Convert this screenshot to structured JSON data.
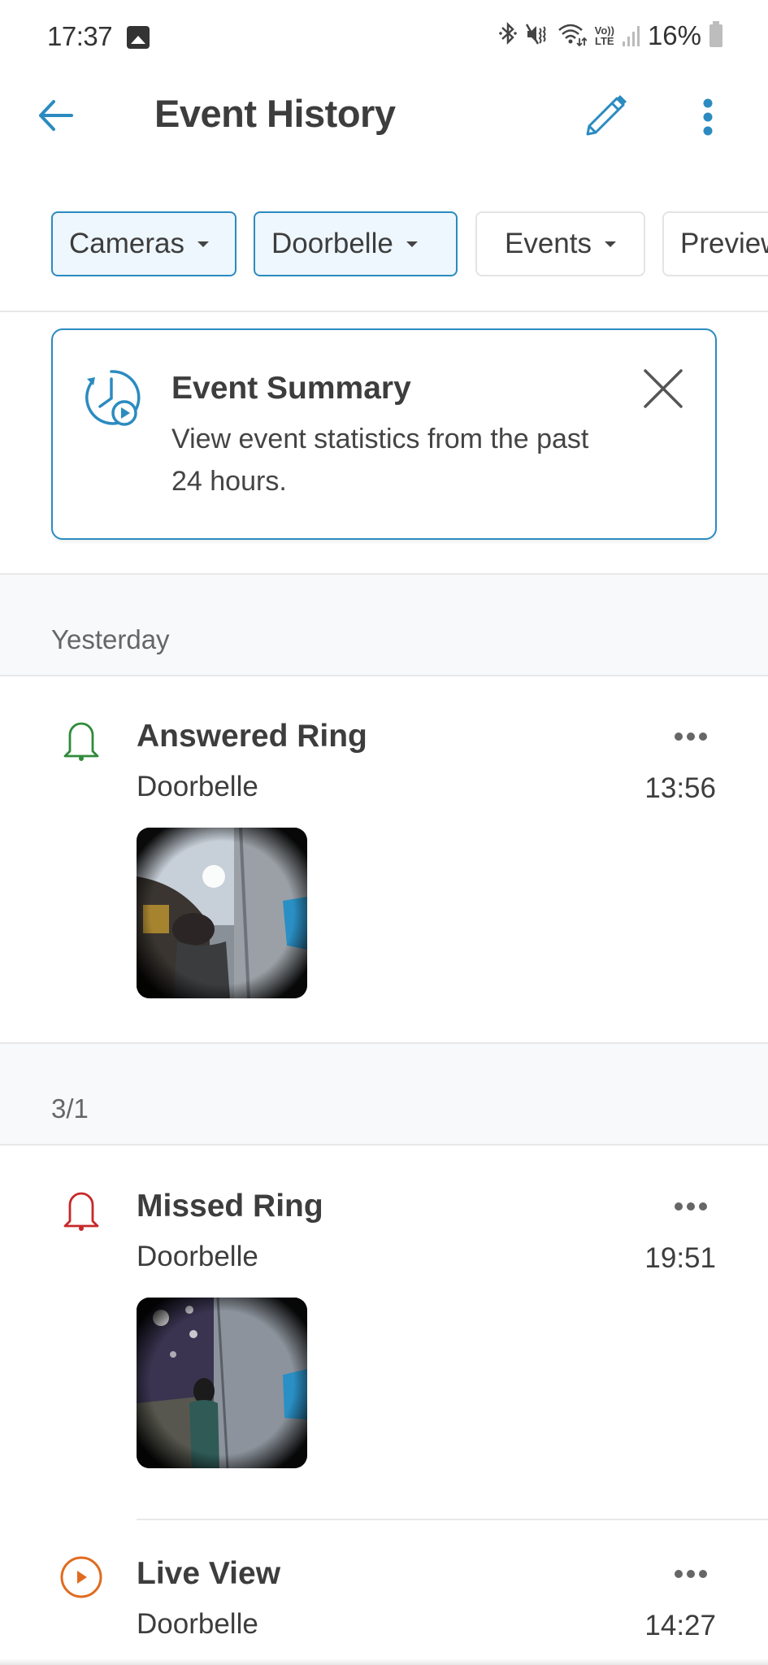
{
  "status_bar": {
    "time": "17:37",
    "notification_icon": "image-icon",
    "icons": [
      "bluetooth-icon",
      "mute-vibrate-icon",
      "wifi-icon",
      "volte-icon",
      "signal-icon"
    ],
    "volte_top": "Vo))",
    "volte_bottom": "LTE",
    "battery_percent": "16%"
  },
  "header": {
    "title": "Event History",
    "back_icon": "arrow-left-icon",
    "edit_icon": "pencil-icon",
    "more_icon": "more-vertical-icon"
  },
  "filters": [
    {
      "label": "Cameras",
      "active": true
    },
    {
      "label": "Doorbelle",
      "active": true
    },
    {
      "label": "Events",
      "active": false
    },
    {
      "label": "Preview",
      "active": false
    }
  ],
  "summary_card": {
    "title": "Event Summary",
    "text": "View event statistics from the past 24 hours.",
    "icon": "history-play-icon",
    "close_icon": "close-icon"
  },
  "colors": {
    "accent": "#2b8bc0",
    "answered": "#2e8b3a",
    "missed": "#c62828",
    "live": "#e06b1f"
  },
  "sections": [
    {
      "date": "Yesterday",
      "events": [
        {
          "type": "Answered Ring",
          "device": "Doorbelle",
          "time": "13:56",
          "icon": "bell-icon",
          "has_thumbnail": true
        }
      ]
    },
    {
      "date": "3/1",
      "events": [
        {
          "type": "Missed Ring",
          "device": "Doorbelle",
          "time": "19:51",
          "icon": "bell-icon",
          "has_thumbnail": true
        },
        {
          "type": "Live View",
          "device": "Doorbelle",
          "time": "14:27",
          "icon": "play-circle-icon",
          "has_thumbnail": false
        }
      ]
    }
  ]
}
